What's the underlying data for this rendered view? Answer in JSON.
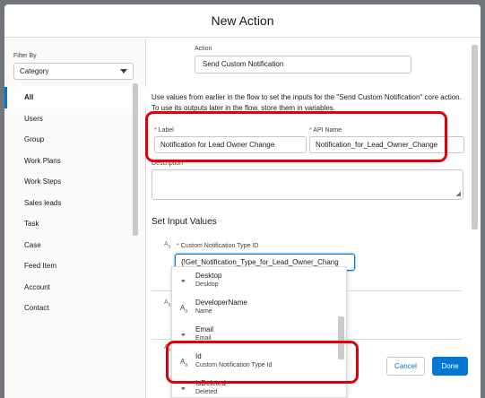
{
  "modal": {
    "title": "New Action"
  },
  "sidebar": {
    "filter_label": "Filter By",
    "filter_value": "Category",
    "items": [
      {
        "label": "All",
        "active": true
      },
      {
        "label": "Users"
      },
      {
        "label": "Group"
      },
      {
        "label": "Work Plans"
      },
      {
        "label": "Work Steps"
      },
      {
        "label": "Sales leads"
      },
      {
        "label": "Task"
      },
      {
        "label": "Case"
      },
      {
        "label": "Feed Item"
      },
      {
        "label": "Account"
      },
      {
        "label": "Contact"
      }
    ]
  },
  "main": {
    "action_label": "Action",
    "action_value": "Send Custom Notification",
    "intro": "Use values from earlier in the flow to set the inputs for the \"Send Custom Notification\" core action. To use its outputs later in the flow, store them in variables.",
    "label_field": {
      "label": "Label",
      "value": "Notification for Lead Owner Change"
    },
    "api_field": {
      "label": "API Name",
      "value": "Notification_for_Lead_Owner_Change"
    },
    "description_label": "Description",
    "section_title": "Set Input Values",
    "type_field": {
      "label": "Custom Notification Type ID",
      "value": "{!Get_Notification_Type_for_Lead_Owner_Chang"
    }
  },
  "dropdown": {
    "items": [
      {
        "title": "Desktop",
        "subtitle": "Desktop",
        "icon": "toggle-icon"
      },
      {
        "title": "DeveloperName",
        "subtitle": "Name",
        "icon": "text-icon"
      },
      {
        "title": "Email",
        "subtitle": "Email",
        "icon": "toggle-icon"
      },
      {
        "title": "Id",
        "subtitle": "Custom Notification Type Id",
        "icon": "text-icon"
      },
      {
        "title": "IsDeleted",
        "subtitle": "Deleted",
        "icon": "toggle-icon"
      }
    ]
  },
  "footer": {
    "cancel_label": "Cancel",
    "done_label": "Done"
  },
  "colors": {
    "brand": "#0176d3",
    "highlight": "#e0000b",
    "required": "#c23934"
  }
}
